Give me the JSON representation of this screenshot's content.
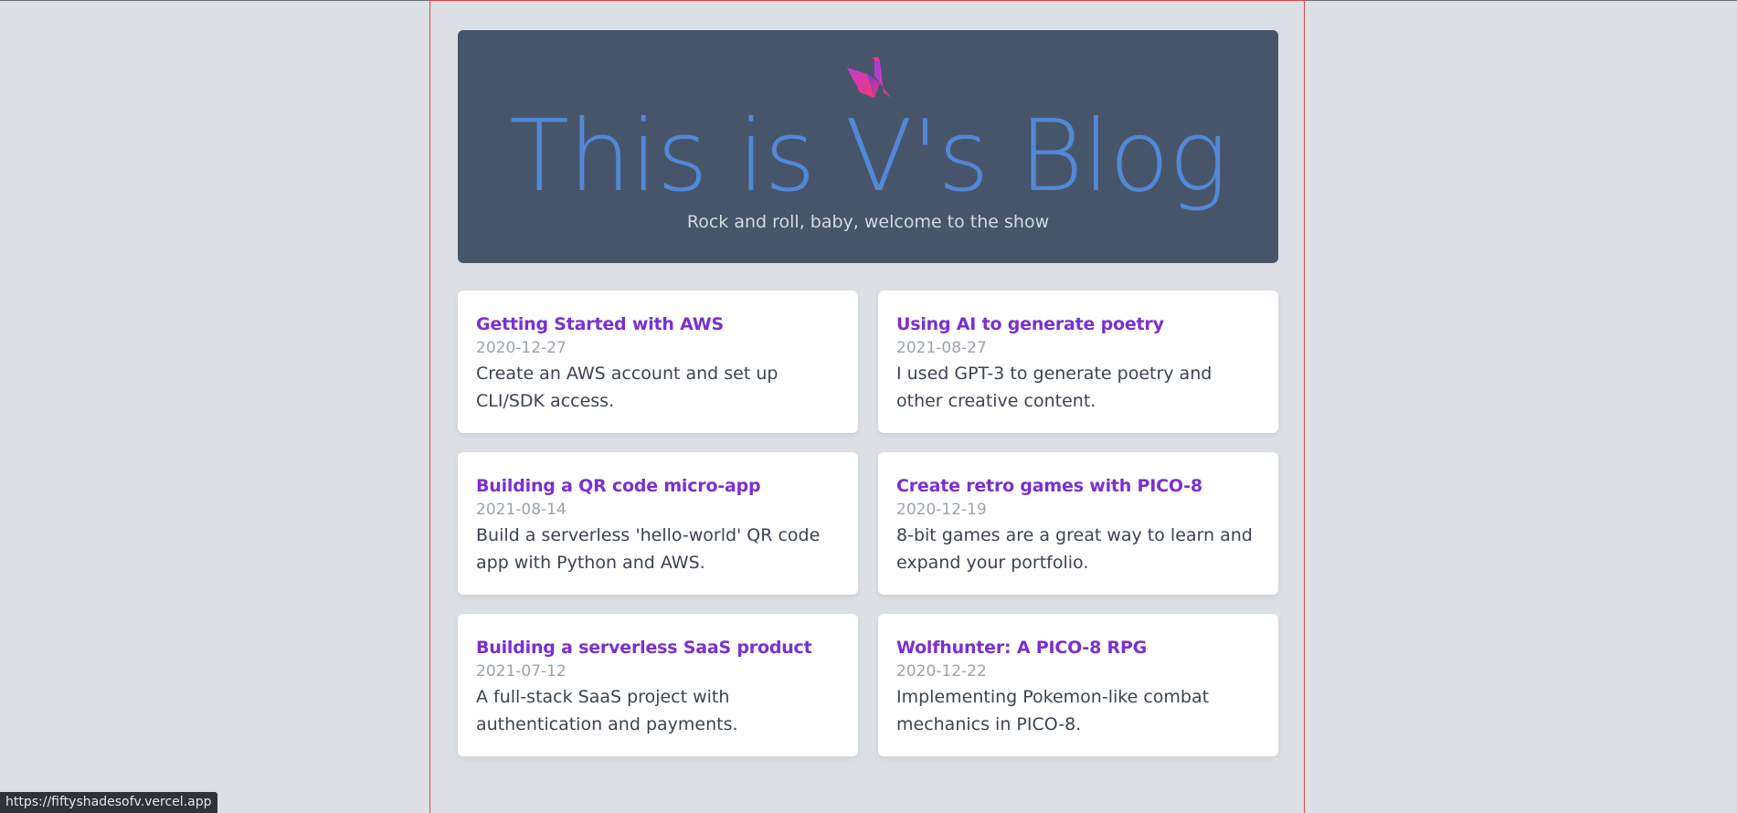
{
  "hero": {
    "title": "This is V's Blog",
    "subtitle": "Rock and roll, baby, welcome to the show",
    "logo_icon": "origami-swan-icon"
  },
  "posts": [
    {
      "title": "Getting Started with AWS",
      "date": "2020-12-27",
      "description": "Create an AWS account and set up CLI/SDK access."
    },
    {
      "title": "Using AI to generate poetry",
      "date": "2021-08-27",
      "description": "I used GPT-3 to generate poetry and other creative content."
    },
    {
      "title": "Building a QR code micro-app",
      "date": "2021-08-14",
      "description": "Build a serverless 'hello-world' QR code app with Python and AWS."
    },
    {
      "title": "Create retro games with PICO-8",
      "date": "2020-12-19",
      "description": "8-bit games are a great way to learn and expand your portfolio."
    },
    {
      "title": "Building a serverless SaaS product",
      "date": "2021-07-12",
      "description": "A full-stack SaaS project with authentication and payments."
    },
    {
      "title": "Wolfhunter: A PICO-8 RPG",
      "date": "2020-12-22",
      "description": "Implementing Pokemon-like combat mechanics in PICO-8."
    }
  ],
  "status_bar": {
    "url": "https://fiftyshadesofv.vercel.app"
  },
  "colors": {
    "page_background": "#dcdfe3",
    "hero_background": "#47556b",
    "hero_title": "#5288d6",
    "post_title": "#7b2fd0",
    "post_date": "#9aa3ad",
    "container_border": "#e0474c"
  }
}
